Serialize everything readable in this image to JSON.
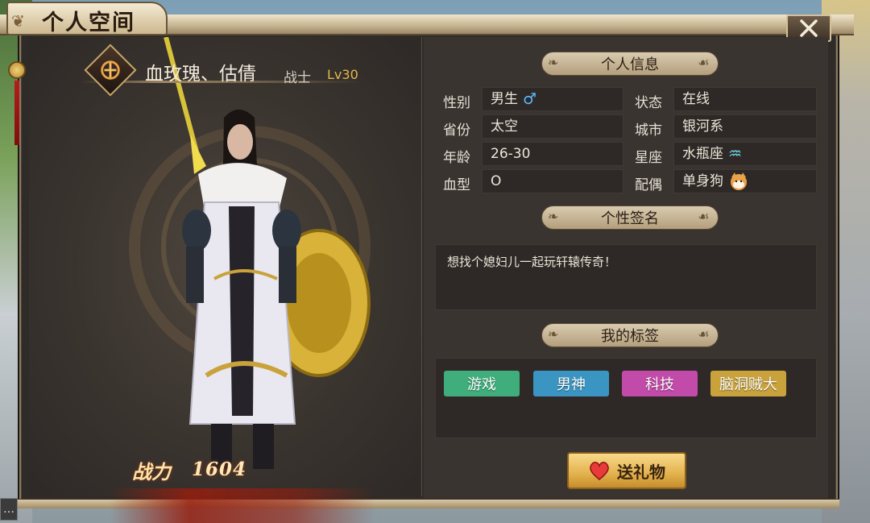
{
  "window": {
    "title": "个人空间",
    "close_label": "✕"
  },
  "character": {
    "name": "血玫瑰、估倩",
    "class": "战士",
    "level": "Lv30",
    "power_label": "战力",
    "power_value": "1604"
  },
  "sections": {
    "personal_info": "个人信息",
    "signature": "个性签名",
    "tags": "我的标签"
  },
  "info": {
    "gender": {
      "label": "性别",
      "value": "男生"
    },
    "status": {
      "label": "状态",
      "value": "在线"
    },
    "province": {
      "label": "省份",
      "value": "太空"
    },
    "city": {
      "label": "城市",
      "value": "银河系"
    },
    "age": {
      "label": "年龄",
      "value": "26-30"
    },
    "zodiac": {
      "label": "星座",
      "value": "水瓶座"
    },
    "blood": {
      "label": "血型",
      "value": "O"
    },
    "spouse": {
      "label": "配偶",
      "value": "单身狗"
    }
  },
  "signature_text": "想找个媳妇儿一起玩轩辕传奇！",
  "tags": [
    {
      "label": "游戏",
      "color": "#3fae7c"
    },
    {
      "label": "男神",
      "color": "#3a95c2"
    },
    {
      "label": "科技",
      "color": "#c24aa8"
    },
    {
      "label": "脑洞贼大",
      "color": "#c9a23c"
    }
  ],
  "gift_button": "送礼物",
  "colors": {
    "accent_gold": "#e4b84a",
    "panel_dark": "#2e2926"
  },
  "icons": [
    "class-emblem-icon",
    "male-symbol-icon",
    "aquarius-icon",
    "shiba-dog-icon",
    "heart-icon",
    "close-icon",
    "chat-icon"
  ]
}
